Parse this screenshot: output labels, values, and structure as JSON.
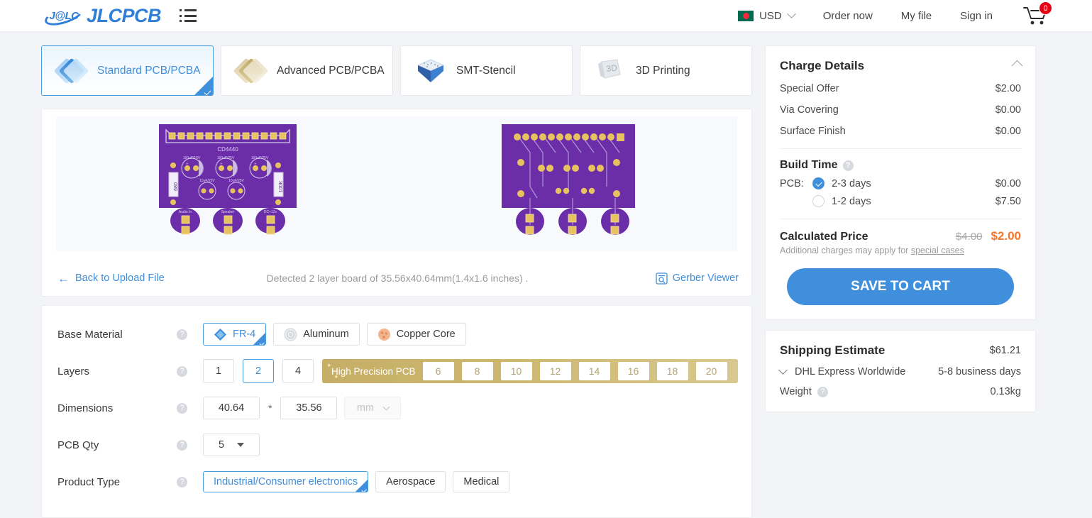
{
  "header": {
    "logo_badge": "J@LC",
    "logo_text": "JLCPCB",
    "menu_icon": "list-icon",
    "currency": "USD",
    "flag": "bangladesh-flag",
    "nav": [
      {
        "label": "Order now"
      },
      {
        "label": "My file"
      },
      {
        "label": "Sign in"
      }
    ],
    "cart_count": "0"
  },
  "tabs": [
    {
      "label": "Standard PCB/PCBA",
      "icon": "pcb-diamond-icon",
      "active": true
    },
    {
      "label": "Advanced PCB/PCBA",
      "icon": "advanced-diamond-icon",
      "active": false
    },
    {
      "label": "SMT-Stencil",
      "icon": "stencil-icon",
      "active": false
    },
    {
      "label": "3D Printing",
      "icon": "3d-printing-icon",
      "active": false
    }
  ],
  "preview": {
    "back_link": "Back to Upload File",
    "detected_text": "Detected 2 layer board of 35.56x40.64mm(1.4x1.6 inches) .",
    "gerber_viewer": "Gerber Viewer",
    "board_front": {
      "silkscreen_title": "CD4440",
      "caps_top": [
        "100uF/16V",
        "100uF/25V",
        "100uF/25V"
      ],
      "caps_mid": [
        "10uF/25V",
        "10uF/25V"
      ],
      "resistor_left": "680",
      "resistor_right": "100K",
      "connectors": [
        "Audio In",
        "Speaker",
        "DC+12v"
      ]
    }
  },
  "options": {
    "base_material": {
      "label": "Base Material",
      "choices": [
        {
          "label": "FR-4",
          "icon": "fr4-icon",
          "selected": true
        },
        {
          "label": "Aluminum",
          "icon": "aluminum-icon",
          "selected": false
        },
        {
          "label": "Copper Core",
          "icon": "copper-core-icon",
          "selected": false
        }
      ]
    },
    "layers": {
      "label": "Layers",
      "basic": [
        {
          "label": "1",
          "selected": false
        },
        {
          "label": "2",
          "selected": true
        },
        {
          "label": "4",
          "selected": false
        }
      ],
      "high_precision_title": "High Precision PCB",
      "high_precision": [
        "6",
        "8",
        "10",
        "12",
        "14",
        "16",
        "18",
        "20"
      ]
    },
    "dimensions": {
      "label": "Dimensions",
      "width": "40.64",
      "separator": "*",
      "height": "35.56",
      "unit": "mm"
    },
    "pcb_qty": {
      "label": "PCB Qty",
      "value": "5"
    },
    "product_type": {
      "label": "Product Type",
      "choices": [
        {
          "label": "Industrial/Consumer electronics",
          "selected": true
        },
        {
          "label": "Aerospace",
          "selected": false
        },
        {
          "label": "Medical",
          "selected": false
        }
      ]
    }
  },
  "charge_details": {
    "title": "Charge Details",
    "rows": [
      {
        "name": "Special Offer",
        "value": "$2.00"
      },
      {
        "name": "Via Covering",
        "value": "$0.00"
      },
      {
        "name": "Surface Finish",
        "value": "$0.00"
      }
    ],
    "build_time": {
      "title": "Build Time",
      "prefix": "PCB:",
      "options": [
        {
          "label": "2-3 days",
          "price": "$0.00",
          "selected": true
        },
        {
          "label": "1-2 days",
          "price": "$7.50",
          "selected": false
        }
      ]
    },
    "calculated_price": {
      "title": "Calculated Price",
      "old_price": "$4.00",
      "new_price": "$2.00",
      "note_prefix": "Additional charges may apply for ",
      "note_link": "special cases"
    },
    "save_to_cart": "SAVE TO CART"
  },
  "shipping": {
    "title": "Shipping Estimate",
    "price": "$61.21",
    "carrier": "DHL Express Worldwide",
    "eta": "5-8 business days",
    "weight_label": "Weight",
    "weight_value": "0.13kg"
  },
  "colors": {
    "accent_blue": "#3f8fdc",
    "orange": "#f5772b",
    "gold": "#c6ae66",
    "pcb_purple": "#6b2ea8",
    "badge_red": "#e60012"
  }
}
